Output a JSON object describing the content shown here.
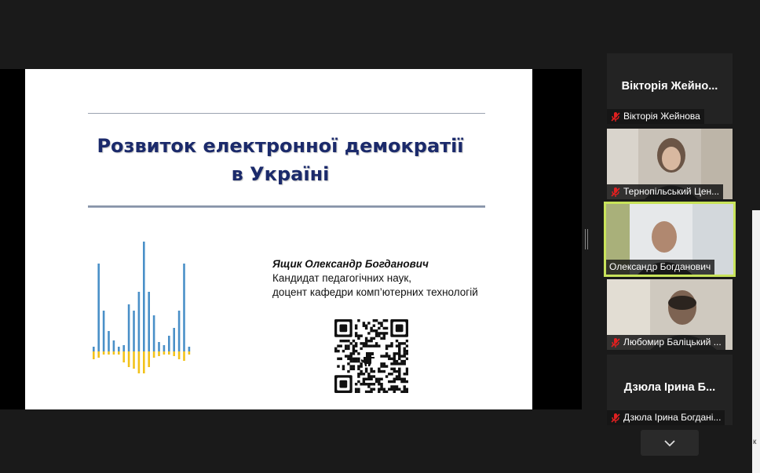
{
  "slide": {
    "title_line1": "Розвиток електронної демократії",
    "title_line2": "в Україні",
    "author_name": "Ящик Олександр Богданович",
    "author_degree": "Кандидат педагогічних наук,",
    "author_position": "доцент кафедри комп’ютерних технологій",
    "qr_icon": "dino-qr-code-icon"
  },
  "participants": [
    {
      "display_name": "Вікторія  Жейно...",
      "label": "Вікторія Жейнова",
      "muted": true,
      "video": false
    },
    {
      "label": "Тернопільський Цен...",
      "muted": true,
      "video": true
    },
    {
      "label": "Олександр Богданович",
      "muted": false,
      "video": true,
      "speaking": true
    },
    {
      "label": "Любомир Баліцький ...",
      "muted": true,
      "video": true
    },
    {
      "display_name": "Дзюла Ірина  Б...",
      "label": "Дзюла Ірина Богдані...",
      "muted": true,
      "video": false
    }
  ],
  "right_panel": {
    "partial_text": "к"
  },
  "colors": {
    "slide_title": "#1b2a6b",
    "speaking_border": "#c8e35a",
    "mute_red": "#e02020"
  }
}
